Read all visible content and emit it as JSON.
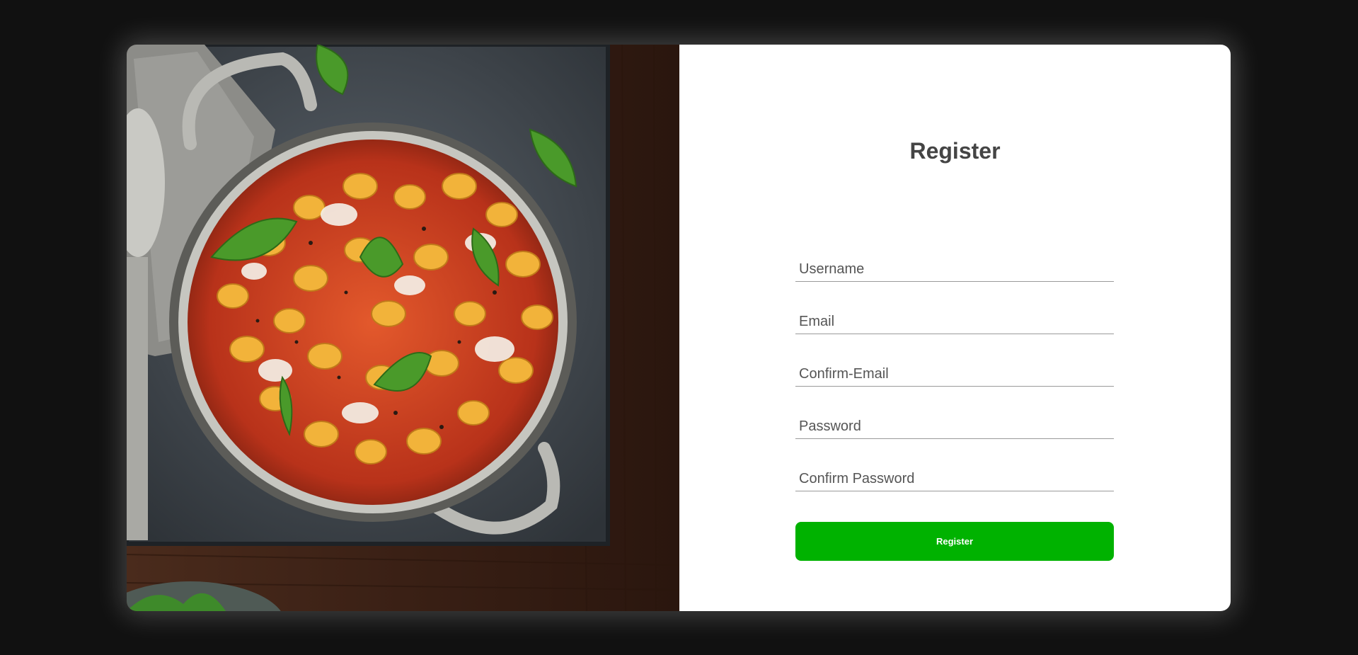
{
  "form": {
    "title": "Register",
    "fields": [
      {
        "name": "username",
        "placeholder": "Username",
        "value": ""
      },
      {
        "name": "email",
        "placeholder": "Email",
        "value": ""
      },
      {
        "name": "confirm-email",
        "placeholder": "Confirm-Email",
        "value": ""
      },
      {
        "name": "password",
        "placeholder": "Password",
        "value": ""
      },
      {
        "name": "confirm-password",
        "placeholder": "Confirm Password",
        "value": ""
      }
    ],
    "submit_label": "Register"
  },
  "colors": {
    "page_background": "#111111",
    "button": "#00b200",
    "title": "#444444",
    "field_underline": "#9a9a9a"
  }
}
